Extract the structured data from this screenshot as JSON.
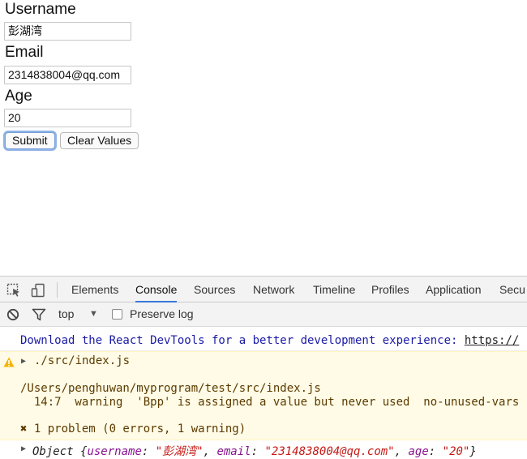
{
  "form": {
    "username_label": "Username",
    "username_value": "彭湖湾",
    "email_label": "Email",
    "email_value": "2314838004@qq.com",
    "age_label": "Age",
    "age_value": "20",
    "submit_label": "Submit",
    "clear_label": "Clear Values"
  },
  "devtools": {
    "tabs": [
      "Elements",
      "Console",
      "Sources",
      "Network",
      "Timeline",
      "Profiles",
      "Application",
      "Secu"
    ],
    "active_tab": "Console",
    "filter": {
      "context": "top",
      "preserve_log_label": "Preserve log"
    },
    "console": {
      "info_text": "Download the React DevTools for a better development experience: ",
      "info_link": "https://",
      "warning_file": "./src/index.js",
      "warning_path": "/Users/penghuwan/myprogram/test/src/index.js",
      "warning_detail": "  14:7  warning  'Bpp' is assigned a value but never used  no-unused-vars",
      "problem_summary": "✖ 1 problem (0 errors, 1 warning)",
      "object_prefix": "Object {",
      "obj_key_username": "username",
      "obj_val_username": "\"彭湖湾\"",
      "obj_key_email": "email",
      "obj_val_email": "\"2314838004@qq.com\"",
      "obj_key_age": "age",
      "obj_val_age": "\"20\"",
      "object_suffix": "}"
    }
  }
}
